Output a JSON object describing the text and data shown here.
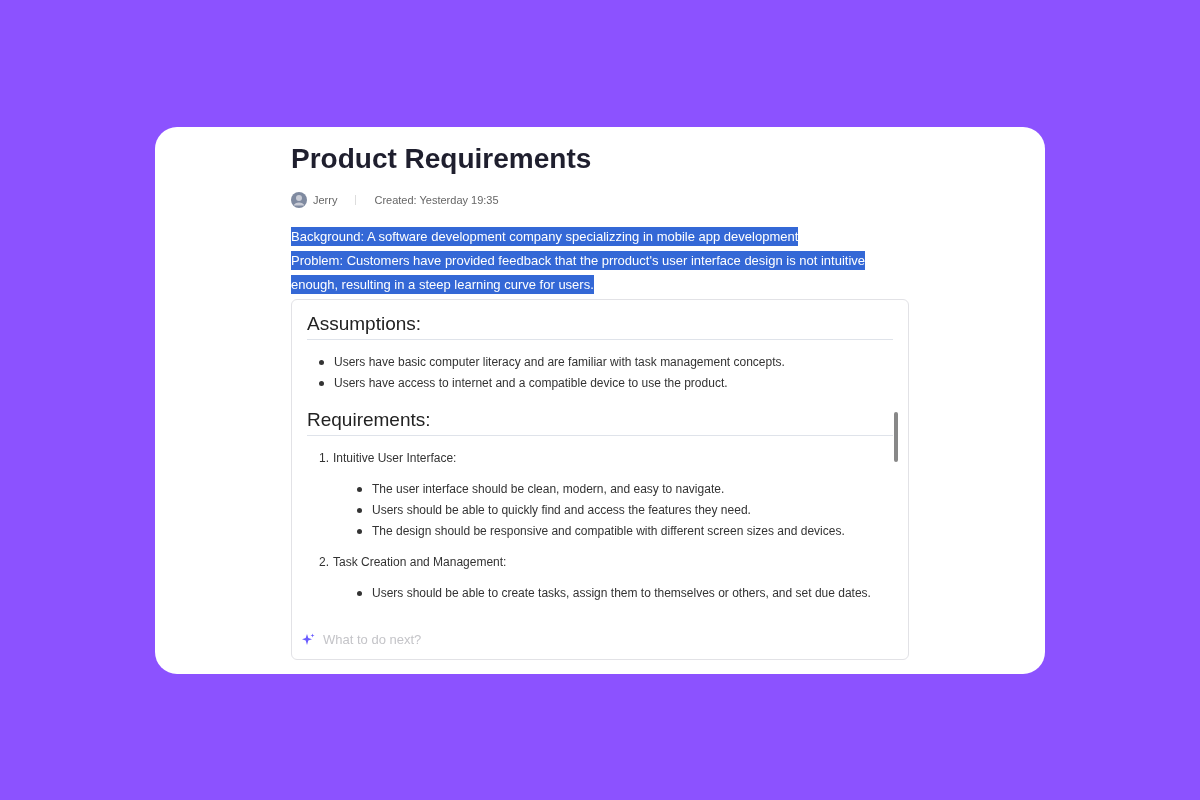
{
  "document": {
    "title": "Product Requirements",
    "author": "Jerry",
    "created": "Created: Yesterday 19:35",
    "selected_paragraphs": [
      {
        "text": "Background: A software development company specializzing in mobile app development",
        "selected": true
      },
      {
        "text": "Problem: Customers have provided feedback that the prroduct's user interface design is not intuitive enough, resulting in a steep learning curve for users.",
        "selected": true
      }
    ]
  },
  "panel": {
    "sections": [
      {
        "heading": "Assumptions:",
        "items": [
          {
            "kind": "bullet",
            "text": "Users have basic computer literacy and are familiar with task management concepts."
          },
          {
            "kind": "bullet",
            "text": "Users have access to internet and a compatible device to use the product."
          }
        ]
      },
      {
        "heading": "Requirements:",
        "items": [
          {
            "kind": "numbered",
            "number": "1.",
            "text": "Intuitive User Interface:",
            "children": [
              {
                "text": "The user interface should be clean, modern, and easy to navigate."
              },
              {
                "text": "Users should be able to quickly find and access the features they need."
              },
              {
                "text": "The design should be responsive and compatible with different screen sizes and devices."
              }
            ]
          },
          {
            "kind": "numbered",
            "number": "2.",
            "text": "Task Creation and Management:",
            "children": [
              {
                "text": "Users should be able to create tasks, assign them to themselves or others, and set due dates."
              }
            ]
          }
        ]
      }
    ],
    "prompt": {
      "placeholder": "What to do next?"
    }
  }
}
